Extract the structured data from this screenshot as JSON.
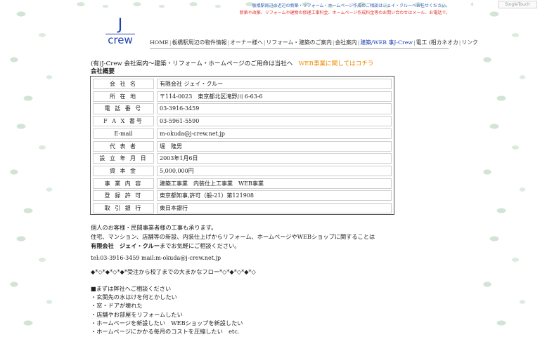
{
  "top_notice": {
    "line1": "板橋駅周辺の近辺の新築・リフォーム・ホームページ作成のご相談はジェイ・クルーへお任せください。",
    "line2": "新築や改築、リフォームや建物の修理工事料金、ホームページ作成料金等のお問い合わせはメール、お電話で。"
  },
  "singletouch_label": "SingleTouch",
  "logo": {
    "top": "J",
    "bottom": "crew"
  },
  "nav": {
    "items": [
      {
        "label": "HOME"
      },
      {
        "label": "板橋駅周辺の物件情報"
      },
      {
        "label": "オーナー様へ"
      },
      {
        "label": "リフォーム・建築のご案内"
      },
      {
        "label": "会社案内"
      },
      {
        "label": "建築/WEB 事J-Crew",
        "active": true
      },
      {
        "label": "電工 (相カネオカ"
      },
      {
        "label": "リンク"
      }
    ]
  },
  "subtitle": {
    "main": "(有)J-Crew 会社案内～建築・リフォーム・ホームページのご用命は当社へ",
    "link": "WEB事業に関してはコチラ"
  },
  "section_title": "会社概要",
  "company": {
    "rows": [
      {
        "label": "会 社 名",
        "value": "有限会社 ジェイ・クルー"
      },
      {
        "label": "所 在 地",
        "value": "〒114-0023　東京都北区滝野川 6-63-6"
      },
      {
        "label": "電 話 番 号",
        "value": "03-3916-3459"
      },
      {
        "label": "F A X 番号",
        "value": "03-5961-5590"
      },
      {
        "label": "E-mail",
        "value": "m-okuda@j-crew.net.jp"
      },
      {
        "label": "代 表 者",
        "value": "堀　隆男"
      },
      {
        "label": "設 立 年 月 日",
        "value": "2003年1月6日"
      },
      {
        "label": "資 本 金",
        "value": "5,000,000円"
      },
      {
        "label": "事 業 内 容",
        "value": "建築工事業　内装仕上工事業　WEB事業"
      },
      {
        "label": "登 録 許 可",
        "value": "東京都知事,許可（般-21）第121908"
      },
      {
        "label": "取 引 銀 行",
        "value": "東日本銀行"
      }
    ]
  },
  "body": {
    "line1": "個人のお客様・民間事業者様の工事も承ります。",
    "line2": "住宅、マンション、店舗等の新設、内装仕上げからリフォーム、ホームページやWEBショップに関することは",
    "line3_bold": "有限会社　ジェイ・クルー",
    "line3_rest": "までお気軽にご相談ください。"
  },
  "contact": "tel:03-3916-3459 mail:m-okuda@j-crew.net.jp",
  "flow": "◆*◇*◆*◇*◆*受注から校了までの大まかなフロー*◇*◆*◇*◆*◇",
  "bullets": {
    "heading": "■まずは弊社へご相談ください",
    "items": [
      "・玄関先の水はけを何とかしたい",
      "・窓・ドアが壊れた",
      "・店舗やお部屋をリフォームしたい",
      "・ホームページを新設したい　WEBショップを新設したい",
      "・ホームページにかかる毎月のコストを圧縮したい　etc."
    ]
  },
  "colors": {
    "accent_blue": "#1f3fb0",
    "link_orange": "#ee8a00",
    "notice_red": "#e0322a"
  }
}
